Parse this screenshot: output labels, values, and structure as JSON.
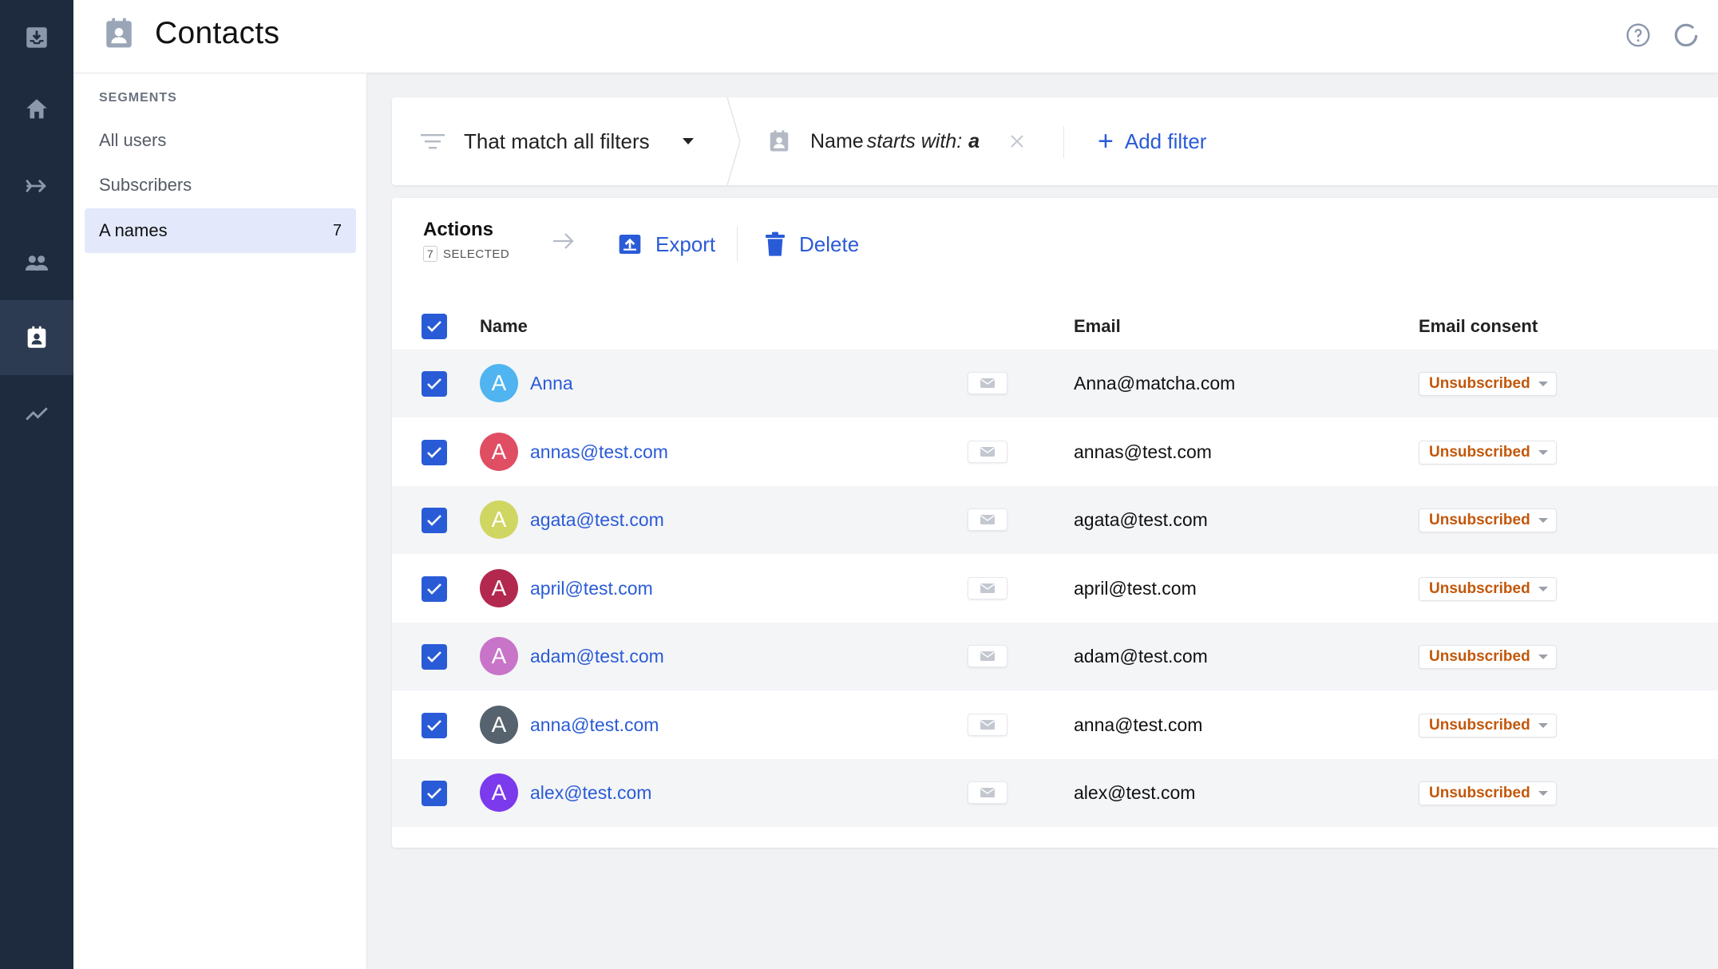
{
  "header": {
    "title": "Contacts"
  },
  "rail": {
    "items": [
      {
        "icon": "inbox-download-icon"
      },
      {
        "icon": "home-icon"
      },
      {
        "icon": "flows-arrow-icon"
      },
      {
        "icon": "users-icon"
      },
      {
        "icon": "contacts-icon",
        "active": true
      },
      {
        "icon": "analytics-icon"
      }
    ]
  },
  "segments": {
    "heading": "SEGMENTS",
    "items": [
      {
        "label": "All users",
        "count": ""
      },
      {
        "label": "Subscribers",
        "count": ""
      },
      {
        "label": "A names",
        "count": "7",
        "active": true
      }
    ]
  },
  "filters": {
    "match_label": "That match all filters",
    "filter": {
      "field": "Name",
      "operator": "starts with:",
      "value": "a"
    },
    "add_label": "Add filter"
  },
  "actions": {
    "title": "Actions",
    "selected_count": "7",
    "selected_label": "SELECTED",
    "export_label": "Export",
    "delete_label": "Delete"
  },
  "table": {
    "columns": {
      "name": "Name",
      "email": "Email",
      "consent": "Email consent"
    },
    "rows": [
      {
        "initial": "A",
        "name": "Anna",
        "email": "Anna@matcha.com",
        "consent": "Unsubscribed",
        "avatar_color": "#4fb4f0"
      },
      {
        "initial": "A",
        "name": "annas@test.com",
        "email": "annas@test.com",
        "consent": "Unsubscribed",
        "avatar_color": "#e04e64"
      },
      {
        "initial": "A",
        "name": "agata@test.com",
        "email": "agata@test.com",
        "consent": "Unsubscribed",
        "avatar_color": "#cfd662"
      },
      {
        "initial": "A",
        "name": "april@test.com",
        "email": "april@test.com",
        "consent": "Unsubscribed",
        "avatar_color": "#b3284f"
      },
      {
        "initial": "A",
        "name": "adam@test.com",
        "email": "adam@test.com",
        "consent": "Unsubscribed",
        "avatar_color": "#c874c9"
      },
      {
        "initial": "A",
        "name": "anna@test.com",
        "email": "anna@test.com",
        "consent": "Unsubscribed",
        "avatar_color": "#56636e"
      },
      {
        "initial": "A",
        "name": "alex@test.com",
        "email": "alex@test.com",
        "consent": "Unsubscribed",
        "avatar_color": "#7c3aed"
      }
    ]
  },
  "colors": {
    "accent": "#2a5bd7",
    "rail_bg": "#1e2a3e",
    "consent_text": "#c2570a"
  }
}
